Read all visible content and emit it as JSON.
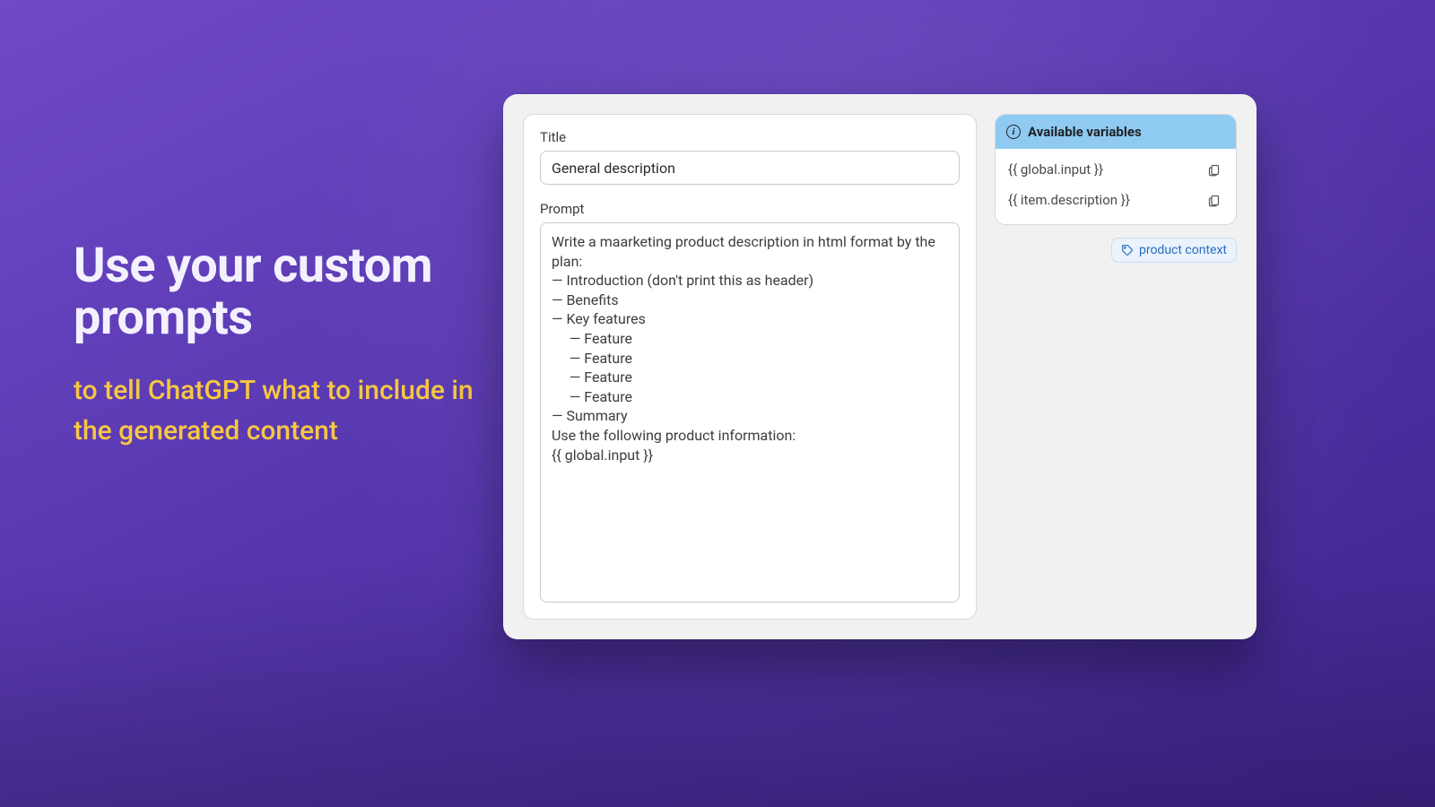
{
  "marketing": {
    "headline": "Use your custom prompts",
    "subhead": "to tell ChatGPT what to include in the generated content"
  },
  "editor": {
    "title_label": "Title",
    "title_value": "General description",
    "prompt_label": "Prompt",
    "prompt_value": "Write a maarketing product description in html format by the plan:\n— Introduction (don't print this as header)\n— Benefits\n— Key features\n     — Feature\n     — Feature\n     — Feature\n     — Feature\n— Summary\nUse the following product information:\n{{ global.input }}"
  },
  "variables": {
    "header": "Available variables",
    "items": [
      {
        "token": "{{ global.input }}"
      },
      {
        "token": "{{ item.description }}"
      }
    ]
  },
  "tag": {
    "label": "product context"
  }
}
